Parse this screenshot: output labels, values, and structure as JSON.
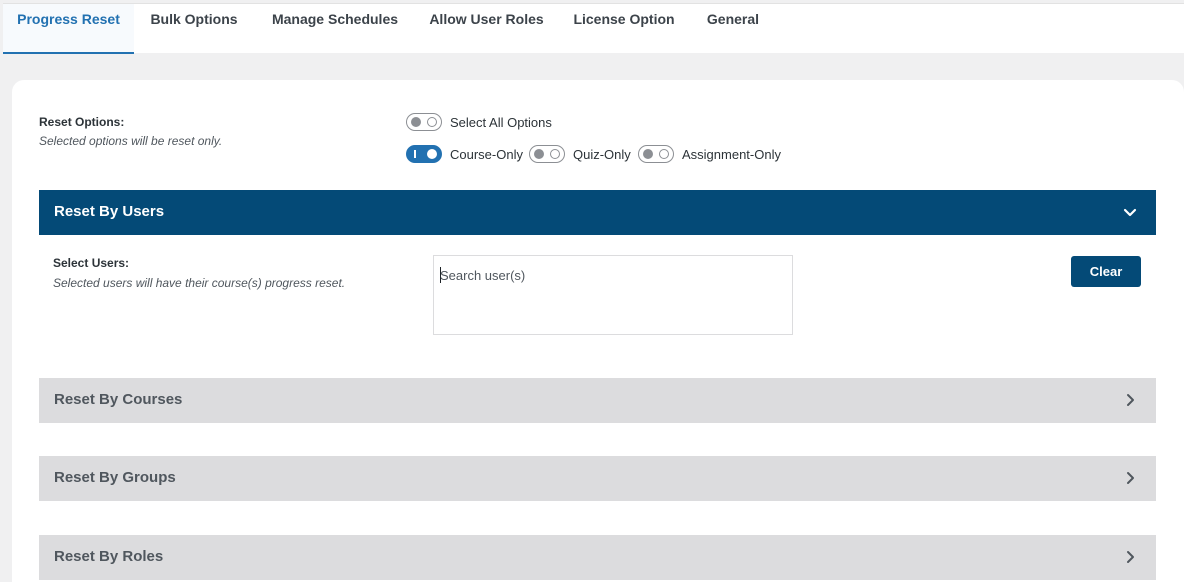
{
  "tabs": [
    {
      "label": "Progress Reset",
      "active": true
    },
    {
      "label": "Bulk Options",
      "active": false
    },
    {
      "label": "Manage Schedules",
      "active": false
    },
    {
      "label": "Allow User Roles",
      "active": false
    },
    {
      "label": "License Option",
      "active": false
    },
    {
      "label": "General",
      "active": false
    }
  ],
  "reset_options": {
    "title": "Reset Options:",
    "description": "Selected options will be reset only.",
    "select_all": {
      "label": "Select All Options",
      "on": false
    },
    "course_only": {
      "label": "Course-Only",
      "on": true
    },
    "quiz_only": {
      "label": "Quiz-Only",
      "on": false
    },
    "assignment_only": {
      "label": "Assignment-Only",
      "on": false
    }
  },
  "sections": {
    "users": {
      "title": "Reset By Users",
      "expanded": true
    },
    "courses": {
      "title": "Reset By Courses",
      "expanded": false
    },
    "groups": {
      "title": "Reset By Groups",
      "expanded": false
    },
    "roles": {
      "title": "Reset By Roles",
      "expanded": false
    }
  },
  "select_users": {
    "title": "Select Users:",
    "description": "Selected users will have their course(s) progress reset.",
    "search_placeholder": "Search user(s)",
    "clear_label": "Clear"
  },
  "colors": {
    "accent": "#2271b1",
    "header_open": "#044a77",
    "header_closed": "#dcdcde"
  }
}
